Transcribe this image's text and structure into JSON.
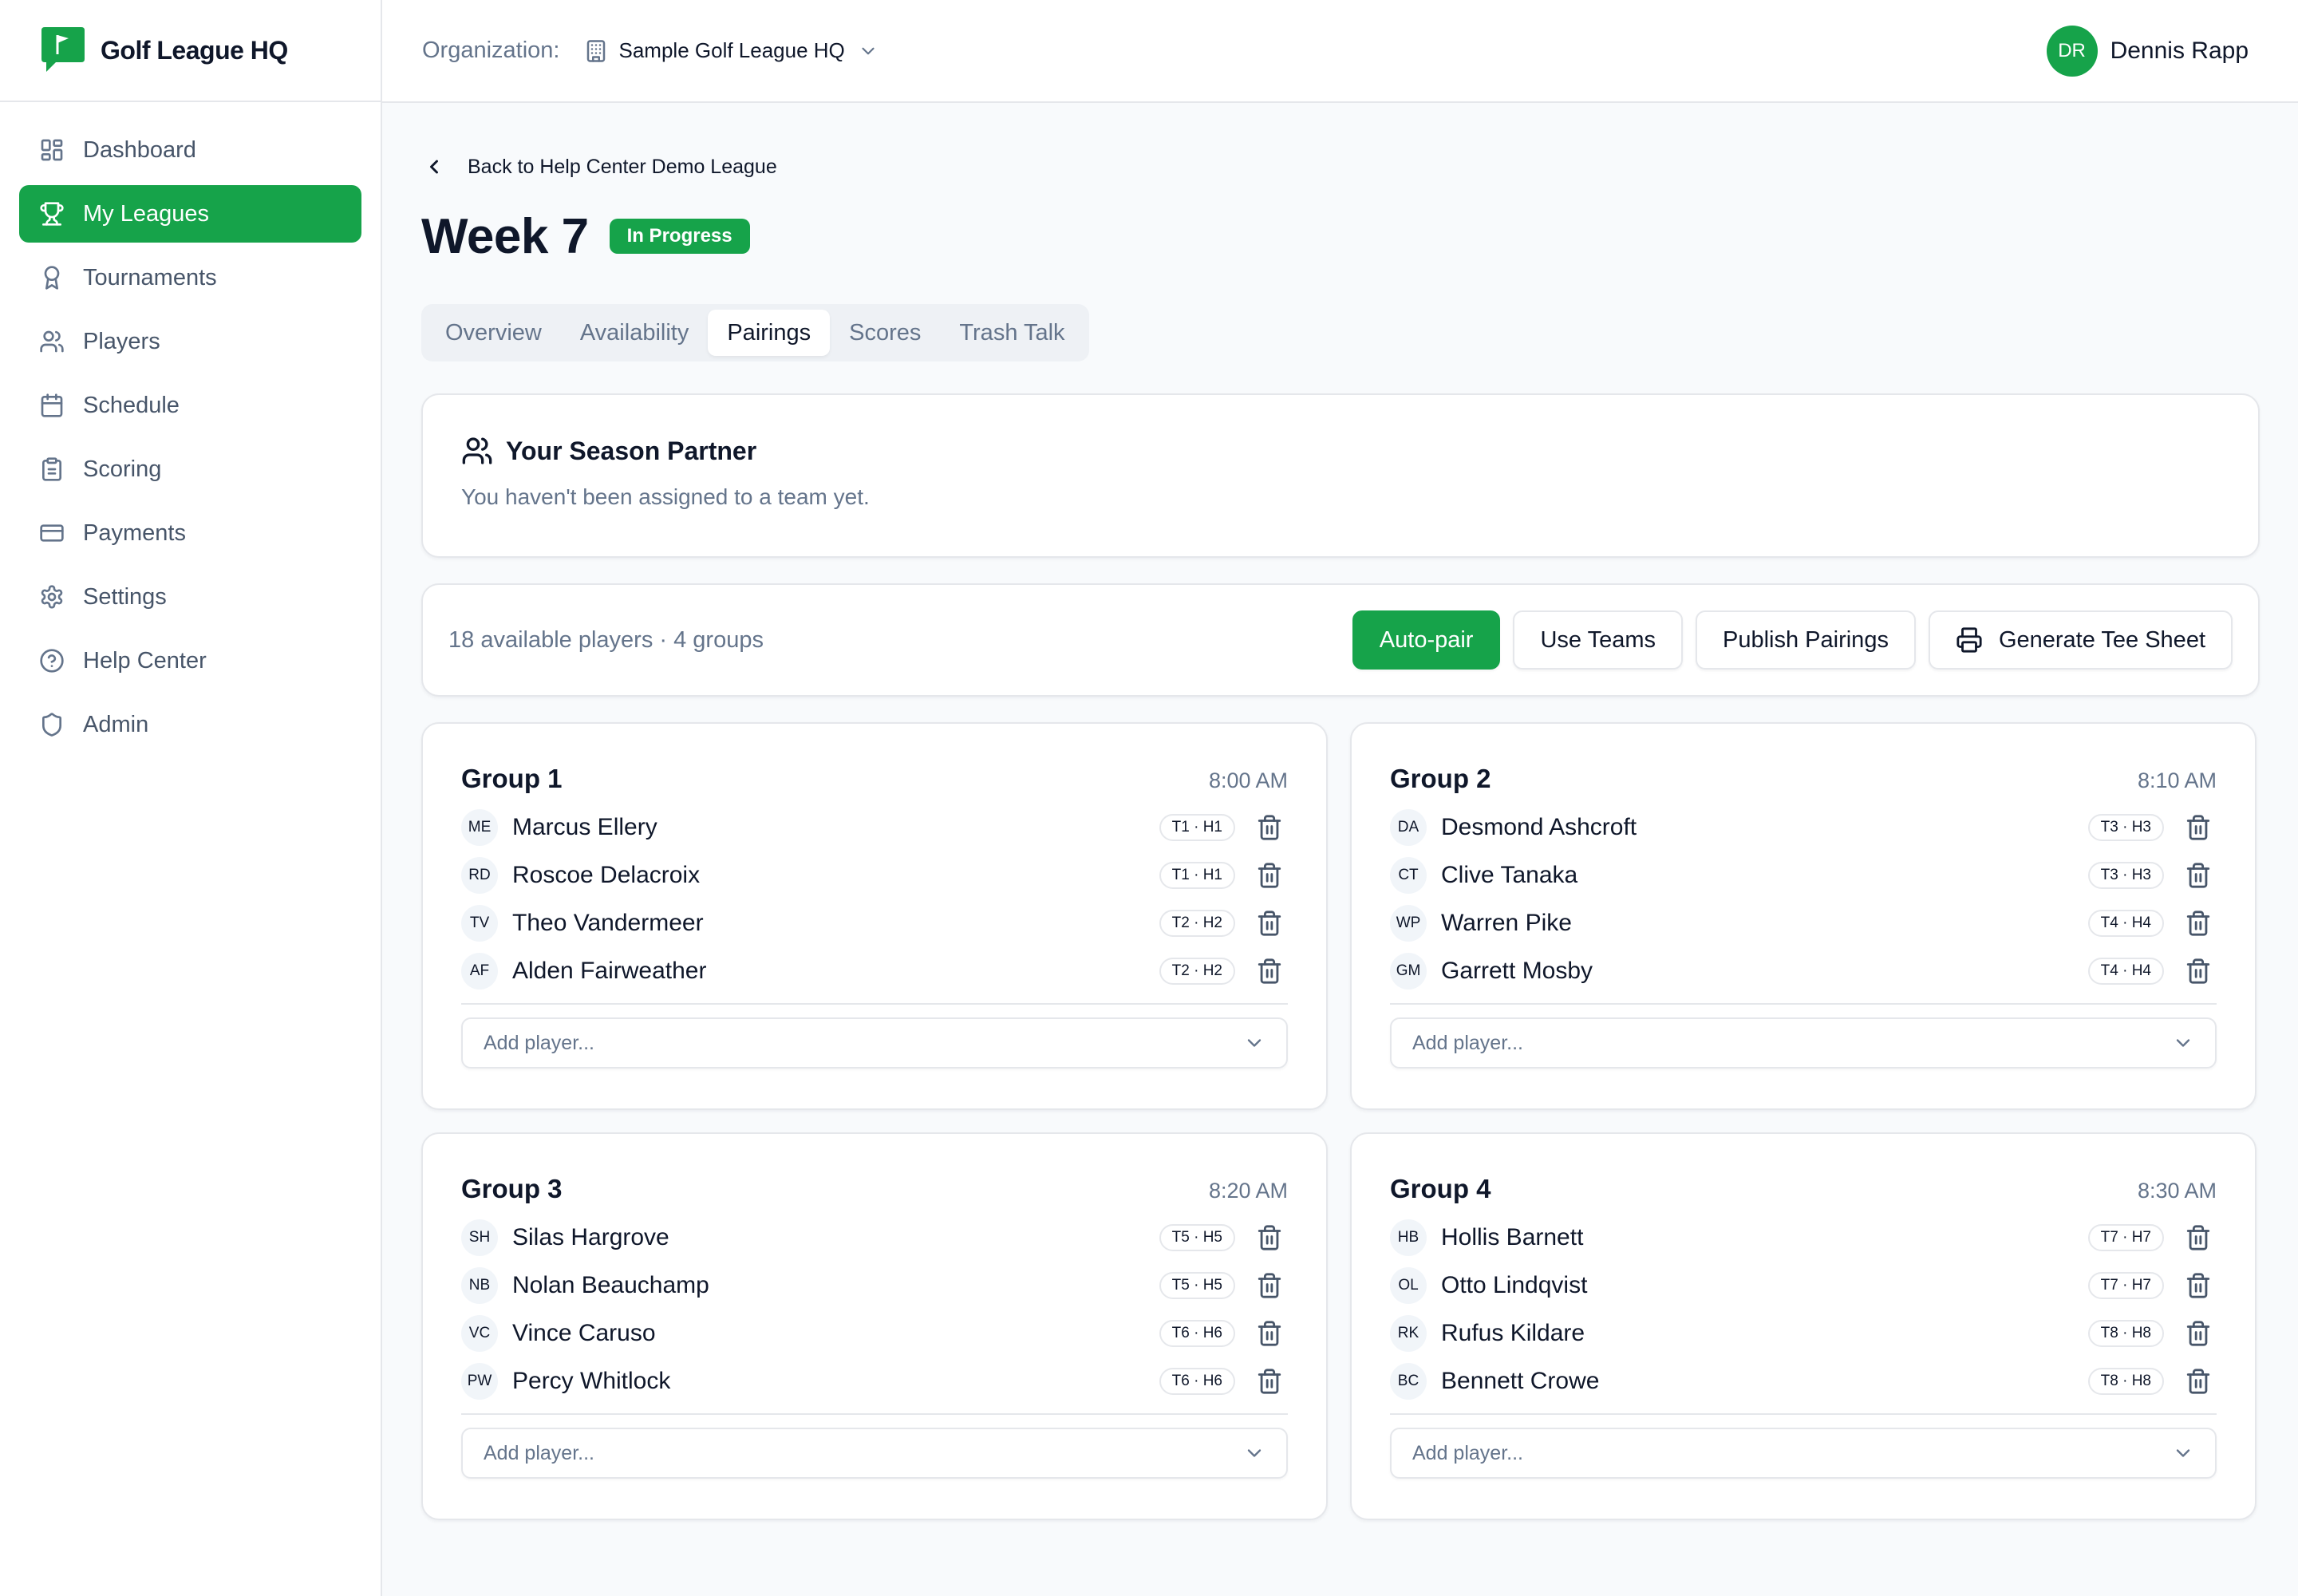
{
  "brand": {
    "name": "Golf League HQ",
    "logo_icon": "flag-icon",
    "accent": "#16a34a"
  },
  "sidebar": {
    "items": [
      {
        "label": "Dashboard",
        "icon": "dashboard-icon"
      },
      {
        "label": "My Leagues",
        "icon": "trophy-icon",
        "active": true
      },
      {
        "label": "Tournaments",
        "icon": "award-icon"
      },
      {
        "label": "Players",
        "icon": "users-icon"
      },
      {
        "label": "Schedule",
        "icon": "calendar-icon"
      },
      {
        "label": "Scoring",
        "icon": "clipboard-icon"
      },
      {
        "label": "Payments",
        "icon": "credit-card-icon"
      },
      {
        "label": "Settings",
        "icon": "gear-icon"
      },
      {
        "label": "Help Center",
        "icon": "help-circle-icon"
      },
      {
        "label": "Admin",
        "icon": "shield-icon"
      }
    ]
  },
  "topbar": {
    "org_label": "Organization:",
    "org_name": "Sample Golf League HQ",
    "user_initials": "DR",
    "user_name": "Dennis Rapp"
  },
  "page": {
    "back_label": "Back to Help Center Demo League",
    "title": "Week 7",
    "status_badge": "In Progress",
    "tabs": [
      "Overview",
      "Availability",
      "Pairings",
      "Scores",
      "Trash Talk"
    ],
    "active_tab": "Pairings"
  },
  "partner": {
    "title": "Your Season Partner",
    "message": "You haven't been assigned to a team yet."
  },
  "toolbar": {
    "summary": "18 available players · 4 groups",
    "auto_pair": "Auto-pair",
    "use_teams": "Use Teams",
    "publish": "Publish Pairings",
    "tee_sheet": "Generate Tee Sheet"
  },
  "groups": [
    {
      "name": "Group 1",
      "time": "8:00 AM",
      "add_placeholder": "Add player...",
      "players": [
        {
          "initials": "ME",
          "name": "Marcus Ellery",
          "tee": "T1 · H1"
        },
        {
          "initials": "RD",
          "name": "Roscoe Delacroix",
          "tee": "T1 · H1"
        },
        {
          "initials": "TV",
          "name": "Theo Vandermeer",
          "tee": "T2 · H2"
        },
        {
          "initials": "AF",
          "name": "Alden Fairweather",
          "tee": "T2 · H2"
        }
      ]
    },
    {
      "name": "Group 2",
      "time": "8:10 AM",
      "add_placeholder": "Add player...",
      "players": [
        {
          "initials": "DA",
          "name": "Desmond Ashcroft",
          "tee": "T3 · H3"
        },
        {
          "initials": "CT",
          "name": "Clive Tanaka",
          "tee": "T3 · H3"
        },
        {
          "initials": "WP",
          "name": "Warren Pike",
          "tee": "T4 · H4"
        },
        {
          "initials": "GM",
          "name": "Garrett Mosby",
          "tee": "T4 · H4"
        }
      ]
    },
    {
      "name": "Group 3",
      "time": "8:20 AM",
      "add_placeholder": "Add player...",
      "players": [
        {
          "initials": "SH",
          "name": "Silas Hargrove",
          "tee": "T5 · H5"
        },
        {
          "initials": "NB",
          "name": "Nolan Beauchamp",
          "tee": "T5 · H5"
        },
        {
          "initials": "VC",
          "name": "Vince Caruso",
          "tee": "T6 · H6"
        },
        {
          "initials": "PW",
          "name": "Percy Whitlock",
          "tee": "T6 · H6"
        }
      ]
    },
    {
      "name": "Group 4",
      "time": "8:30 AM",
      "add_placeholder": "Add player...",
      "players": [
        {
          "initials": "HB",
          "name": "Hollis Barnett",
          "tee": "T7 · H7"
        },
        {
          "initials": "OL",
          "name": "Otto Lindqvist",
          "tee": "T7 · H7"
        },
        {
          "initials": "RK",
          "name": "Rufus Kildare",
          "tee": "T8 · H8"
        },
        {
          "initials": "BC",
          "name": "Bennett Crowe",
          "tee": "T8 · H8"
        }
      ]
    }
  ]
}
